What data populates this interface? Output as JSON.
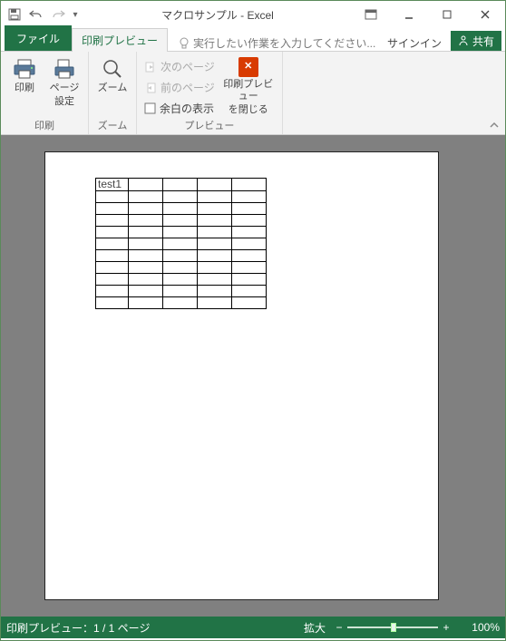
{
  "window": {
    "title": "マクロサンプル - Excel"
  },
  "tabs": {
    "file": "ファイル",
    "preview": "印刷プレビュー",
    "tell_placeholder": "実行したい作業を入力してください...",
    "signin": "サインイン",
    "share": "共有"
  },
  "ribbon": {
    "print_group_label": "印刷",
    "print_button": "印刷",
    "pagesetup_button_line1": "ページ",
    "pagesetup_button_line2": "設定",
    "zoom_group_label": "ズーム",
    "zoom_button": "ズーム",
    "preview_group_label": "プレビュー",
    "next_page": "次のページ",
    "prev_page": "前のページ",
    "show_margins": "余白の表示",
    "close_button_line1": "印刷プレビュー",
    "close_button_line2": "を閉じる"
  },
  "sheet": {
    "cell_a1": "test1"
  },
  "statusbar": {
    "left": "印刷プレビュー：1 / 1 ページ",
    "zoom_label": "拡大",
    "minus": "−",
    "plus": "+",
    "zoom_pct": "100%"
  }
}
